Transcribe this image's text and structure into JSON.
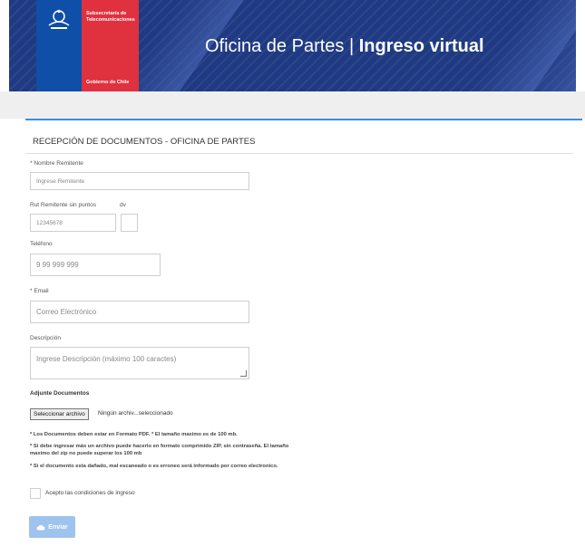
{
  "header": {
    "agency_line": "Subsecretaría de Telecomunicaciones",
    "gov_label": "Gobierno de Chile",
    "title_light": "Oficina de Partes",
    "title_sep": "|",
    "title_bold": "Ingreso virtual",
    "colors": {
      "banner": "#1f3a82",
      "gov_blue": "#0f4fa8",
      "gov_red": "#e0313f"
    }
  },
  "form": {
    "title": "RECEPCIÓN DE DOCUMENTOS - OFICINA DE PARTES",
    "nombre": {
      "label": "* Nombre Remitente",
      "placeholder": "Ingrese Remitente"
    },
    "rut": {
      "label": "Rut Remitente sin puntos",
      "placeholder": "12345678"
    },
    "dv": {
      "label": "dv",
      "value": ""
    },
    "telefono": {
      "label": "Teléfono",
      "placeholder": "9 99 999 999"
    },
    "email": {
      "label": "* Email",
      "placeholder": "Correo Electrónico"
    },
    "descripcion": {
      "label": "Descripción",
      "placeholder": "Ingrese Descripción (máximo 100 caractes)"
    },
    "adjunte": {
      "heading": "Adjunte Documentos",
      "button": "Seleccionar archivo",
      "status": "Ningún archiv...seleccionado"
    },
    "notes": [
      "* Los Documentos deben estar en Formato PDF. * El tamaño maximo es de 100 mb.",
      "* Si debe ingresar más un archivo puede hacerlo en formato comprimido ZIP, sin contraseña. El tamaño maximo del zip no puede superar los 100 mb",
      "* Si el documento esta dañado, mal escaneado o es erroneo será informado por correo electronico."
    ],
    "accept_label": "Acepto las condiciones de ingreso",
    "submit_label": "Enviar",
    "accent_color": "#3a8de0",
    "submit_color": "#9ec3ee"
  }
}
